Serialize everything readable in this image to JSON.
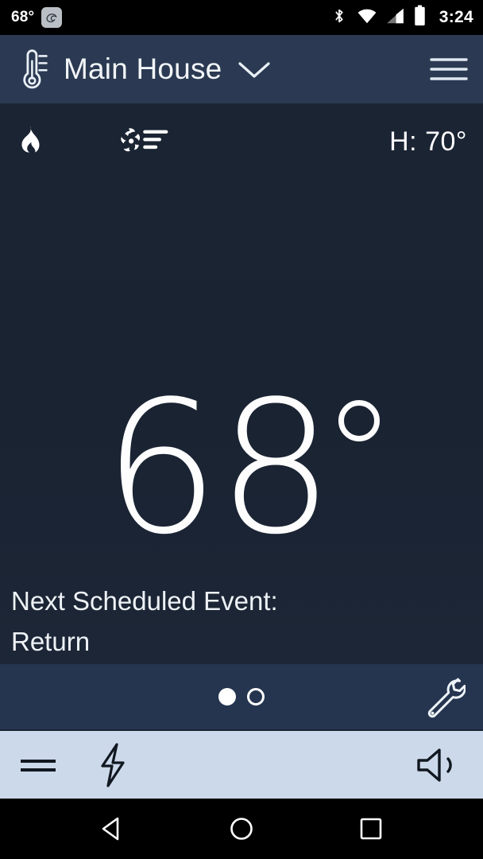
{
  "status_bar": {
    "outdoor_temp": "68°",
    "weather_icon": "cloud-swirl-icon",
    "bluetooth_icon": "bluetooth-icon",
    "wifi_icon": "wifi-icon",
    "signal_icon": "cellular-signal-icon",
    "battery_icon": "battery-full-icon",
    "time": "3:24"
  },
  "app_bar": {
    "thermostat_icon": "thermometer-icon",
    "title": "Main House",
    "dropdown_icon": "chevron-down-icon",
    "menu_icon": "hamburger-menu-icon"
  },
  "main": {
    "heat_icon": "flame-icon",
    "fan_icon": "fan-icon",
    "heat_setpoint": "H: 70°",
    "current_temp": "68",
    "degree_symbol": "°",
    "next_event_label": "Next Scheduled Event:",
    "next_event_value": "Return"
  },
  "pager": {
    "dots": [
      {
        "state": "active"
      },
      {
        "state": "inactive"
      }
    ],
    "settings_icon": "wrench-icon"
  },
  "toolbar": {
    "equals_icon": "equals-menu-icon",
    "bolt_icon": "lightning-bolt-icon",
    "speaker_icon": "speaker-volume-icon"
  },
  "nav_bar": {
    "back_icon": "back-triangle-icon",
    "home_icon": "home-circle-icon",
    "recents_icon": "recents-square-icon"
  },
  "colors": {
    "background": "#1a2332",
    "app_bar": "#2b3a52",
    "pager_bar": "#253550",
    "toolbar": "#ccd9ea",
    "text": "#f2f5f8",
    "nav_bar": "#000000"
  }
}
